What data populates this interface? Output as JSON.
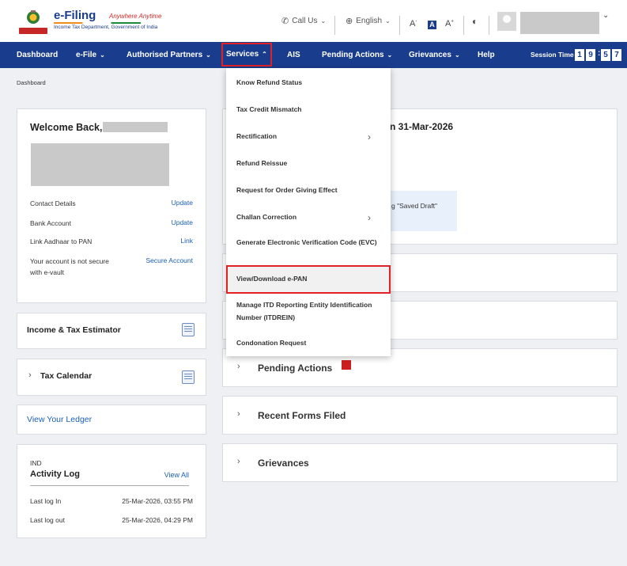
{
  "header": {
    "brand": "e-Filing",
    "tagline": "Anywhere Anytime",
    "dept": "Income Tax Department, Government of India",
    "call_us": "Call Us",
    "language": "English",
    "font_decrease": "A",
    "font_normal": "A",
    "font_increase": "A",
    "font_minus_sup": "-",
    "font_plus_sup": "+"
  },
  "nav": {
    "items": [
      "Dashboard",
      "e-File",
      "Authorised Partners",
      "Services",
      "AIS",
      "Pending Actions",
      "Grievances",
      "Help"
    ],
    "session_label": "Session Time",
    "session_digits": [
      "1",
      "9",
      "5",
      "7"
    ]
  },
  "breadcrumb": "Dashboard",
  "welcome": {
    "title": "Welcome Back,",
    "rows": [
      {
        "label": "Contact Details",
        "action": "Update"
      },
      {
        "label": "Bank Account",
        "action": "Update"
      },
      {
        "label": "Link Aadhaar to PAN",
        "action": "Link"
      },
      {
        "label": "Your account is not secure with e-vault",
        "action": "Secure Account"
      }
    ]
  },
  "sidebar": {
    "estimator": "Income & Tax Estimator",
    "tax_calendar": "Tax Calendar",
    "ledger": "View Your Ledger",
    "activity": {
      "subtitle": "IND",
      "title": "Activity Log",
      "view_all": "View All",
      "rows": [
        {
          "label": "Last log In",
          "value": "25-Mar-2026, 03:55 PM"
        },
        {
          "label": "Last log out",
          "value": "25-Mar-2026, 04:29 PM"
        }
      ]
    }
  },
  "main": {
    "due_fragment": "n 31-Mar-2026",
    "draft_fragment": "g \"Saved Draft\"",
    "accordions": [
      "Pending Actions",
      "Recent Forms Filed",
      "Grievances"
    ]
  },
  "services_menu": {
    "items": [
      {
        "label": "Know Refund Status",
        "submenu": false
      },
      {
        "label": "Tax Credit Mismatch",
        "submenu": false
      },
      {
        "label": "Rectification",
        "submenu": true
      },
      {
        "label": "Refund Reissue",
        "submenu": false
      },
      {
        "label": "Request for Order Giving Effect",
        "submenu": false
      },
      {
        "label": "Challan Correction",
        "submenu": true
      },
      {
        "label": "Generate Electronic Verification Code (EVC)",
        "submenu": false
      },
      {
        "label": "View/Download e-PAN",
        "submenu": false,
        "highlighted": true
      },
      {
        "label": "Manage ITD Reporting Entity Identification Number (ITDREIN)",
        "submenu": false
      },
      {
        "label": "Condonation Request",
        "submenu": false
      }
    ]
  },
  "colors": {
    "nav_bg": "#1a3c8d",
    "highlight": "#e12128",
    "link": "#1a5fb4",
    "badge": "#cc1f1f"
  }
}
